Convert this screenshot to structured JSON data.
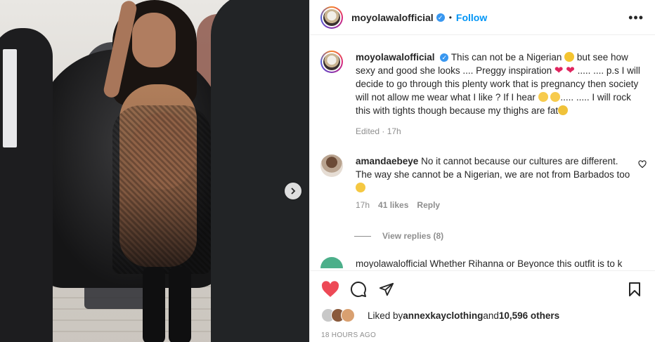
{
  "header": {
    "username": "moyolawalofficial",
    "follow_label": "Follow",
    "more_label": "•••"
  },
  "caption": {
    "username": "moyolawalofficial",
    "part1": "This can not be a Nigerian ",
    "part2": "but see how sexy and good she looks .... Preggy inspiration ",
    "part3": " ..... .... p.s I will decide to go through this plenty work that is pregnancy then society will not allow me wear what I like ? If I hear ",
    "part4": "..... ..... I will rock this with tights though because my thighs are fat",
    "edited": "Edited · 17h"
  },
  "comment1": {
    "username": "amandaebeye",
    "text": "No it cannot because our cultures are different. The way she cannot be a Nigerian, we are not from Barbados too ",
    "time": "17h",
    "likes": "41 likes",
    "reply": "Reply",
    "view_replies": "View replies (8)"
  },
  "comment2": {
    "partial_text": "moyolawalofficial Whether Rihanna or Beyonce this outfit is to k"
  },
  "likes": {
    "prefix": "Liked by ",
    "user": "annexkayclothing",
    "middle": " and ",
    "count": "10,596 others"
  },
  "timestamp": "18 HOURS AGO",
  "colors": {
    "heart_red": "#ed4956",
    "link_blue": "#0095f6",
    "verified_blue": "#3897f0"
  }
}
